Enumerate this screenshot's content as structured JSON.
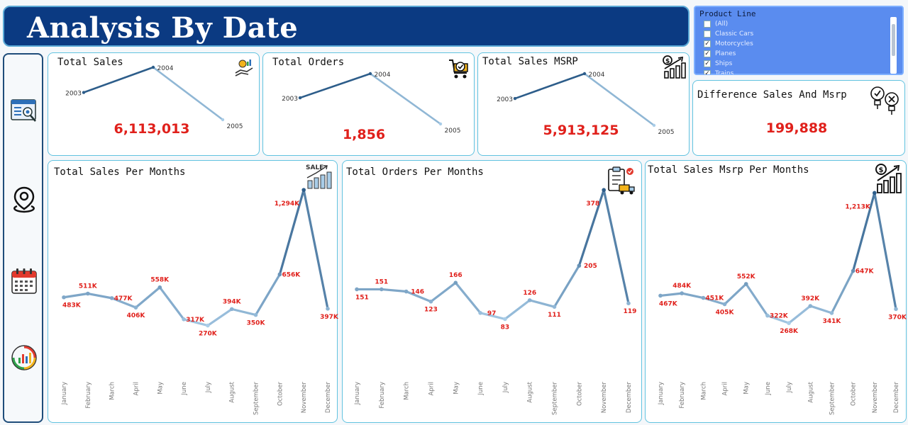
{
  "header": {
    "title": "Analysis By Date"
  },
  "filter": {
    "title": "Product Line",
    "items": [
      {
        "label": "(All)",
        "checked": false
      },
      {
        "label": "Classic Cars",
        "checked": false
      },
      {
        "label": "Motorcycles",
        "checked": true
      },
      {
        "label": "Planes",
        "checked": true
      },
      {
        "label": "Ships",
        "checked": true
      },
      {
        "label": "Trains",
        "checked": true
      }
    ]
  },
  "sidebar": {
    "icons": [
      "dashboard-report-icon",
      "map-pin-icon",
      "calendar-icon",
      "analytics-chart-icon"
    ]
  },
  "kpis": {
    "total_sales": {
      "title": "Total Sales",
      "value": "6,113,013"
    },
    "total_orders": {
      "title": "Total Orders",
      "value": "1,856"
    },
    "total_msrp": {
      "title": "Total Sales MSRP",
      "value": "5,913,125"
    },
    "difference": {
      "title": "Difference Sales And Msrp",
      "value": "199,888"
    }
  },
  "colors": {
    "accent_red": "#e0201b",
    "line_dark": "#2d5d8a",
    "line_light": "#a9cde8",
    "title_bg": "#0b3a82",
    "card_border": "#62c3e0"
  },
  "chart_data": [
    {
      "type": "line",
      "title": "Total Sales",
      "x": [
        "2003",
        "2004",
        "2005"
      ],
      "values": [
        0.52,
        1.0,
        0.0
      ],
      "ylim": [
        0,
        1
      ],
      "labels": [
        "2003",
        "2004",
        "2005"
      ]
    },
    {
      "type": "line",
      "title": "Total Orders",
      "x": [
        "2003",
        "2004",
        "2005"
      ],
      "values": [
        0.52,
        1.0,
        0.0
      ],
      "ylim": [
        0,
        1
      ],
      "labels": [
        "2003",
        "2004",
        "2005"
      ]
    },
    {
      "type": "line",
      "title": "Total Sales MSRP",
      "x": [
        "2003",
        "2004",
        "2005"
      ],
      "values": [
        0.52,
        1.0,
        0.0
      ],
      "ylim": [
        0,
        1
      ],
      "labels": [
        "2003",
        "2004",
        "2005"
      ]
    },
    {
      "type": "line",
      "title": "Total Sales Per Months",
      "categories": [
        "January",
        "February",
        "March",
        "April",
        "May",
        "June",
        "July",
        "August",
        "September",
        "October",
        "November",
        "December"
      ],
      "values": [
        483,
        511,
        477,
        406,
        558,
        317,
        270,
        394,
        350,
        656,
        1294,
        397
      ],
      "labels": [
        "483K",
        "511K",
        "477K",
        "406K",
        "558K",
        "317K",
        "270K",
        "394K",
        "350K",
        "656K",
        "1,294K",
        "397K"
      ],
      "ylim": [
        150,
        1300
      ]
    },
    {
      "type": "line",
      "title": "Total Orders Per Months",
      "categories": [
        "January",
        "February",
        "March",
        "April",
        "May",
        "June",
        "July",
        "August",
        "September",
        "October",
        "November",
        "December"
      ],
      "values": [
        151,
        151,
        146,
        123,
        166,
        97,
        83,
        126,
        111,
        205,
        378,
        119
      ],
      "labels": [
        "151",
        "151",
        "146",
        "123",
        "166",
        "97",
        "83",
        "126",
        "111",
        "205",
        "378",
        "119"
      ],
      "ylim": [
        40,
        380
      ]
    },
    {
      "type": "line",
      "title": "Total Sales Msrp Per Months",
      "categories": [
        "January",
        "February",
        "March",
        "April",
        "May",
        "June",
        "July",
        "August",
        "September",
        "October",
        "November",
        "December"
      ],
      "values": [
        467,
        484,
        451,
        405,
        552,
        322,
        268,
        392,
        341,
        647,
        1213,
        370
      ],
      "labels": [
        "467K",
        "484K",
        "451K",
        "405K",
        "552K",
        "322K",
        "268K",
        "392K",
        "341K",
        "647K",
        "1,213K",
        "370K"
      ],
      "ylim": [
        140,
        1220
      ]
    }
  ]
}
